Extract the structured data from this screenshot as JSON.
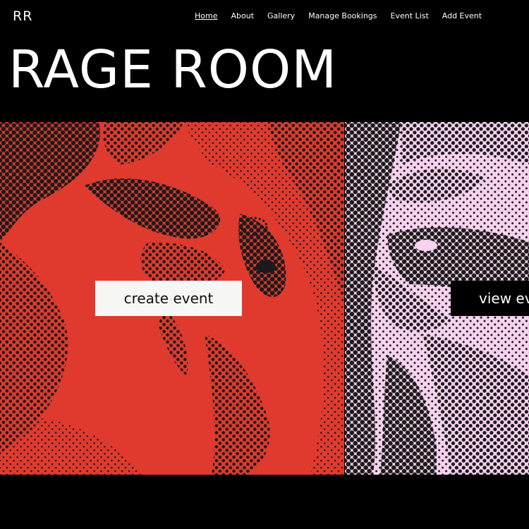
{
  "header": {
    "logo": "RR",
    "nav": [
      {
        "label": "Home",
        "active": true
      },
      {
        "label": "About",
        "active": false
      },
      {
        "label": "Gallery",
        "active": false
      },
      {
        "label": "Manage Bookings",
        "active": false
      },
      {
        "label": "Event List",
        "active": false
      },
      {
        "label": "Add Event",
        "active": false
      }
    ]
  },
  "hero": {
    "title": "RAGE ROOM"
  },
  "panels": {
    "left": {
      "button_label": "create event",
      "image": "halftone-screaming-face-red",
      "tint_color": "#e03a2f"
    },
    "right": {
      "button_label": "view events",
      "image": "halftone-screaming-face-pink",
      "tint_color": "#f7d3ef"
    }
  },
  "colors": {
    "background": "#000000",
    "text": "#ffffff",
    "halftone_ink": "#1a1a1a"
  }
}
